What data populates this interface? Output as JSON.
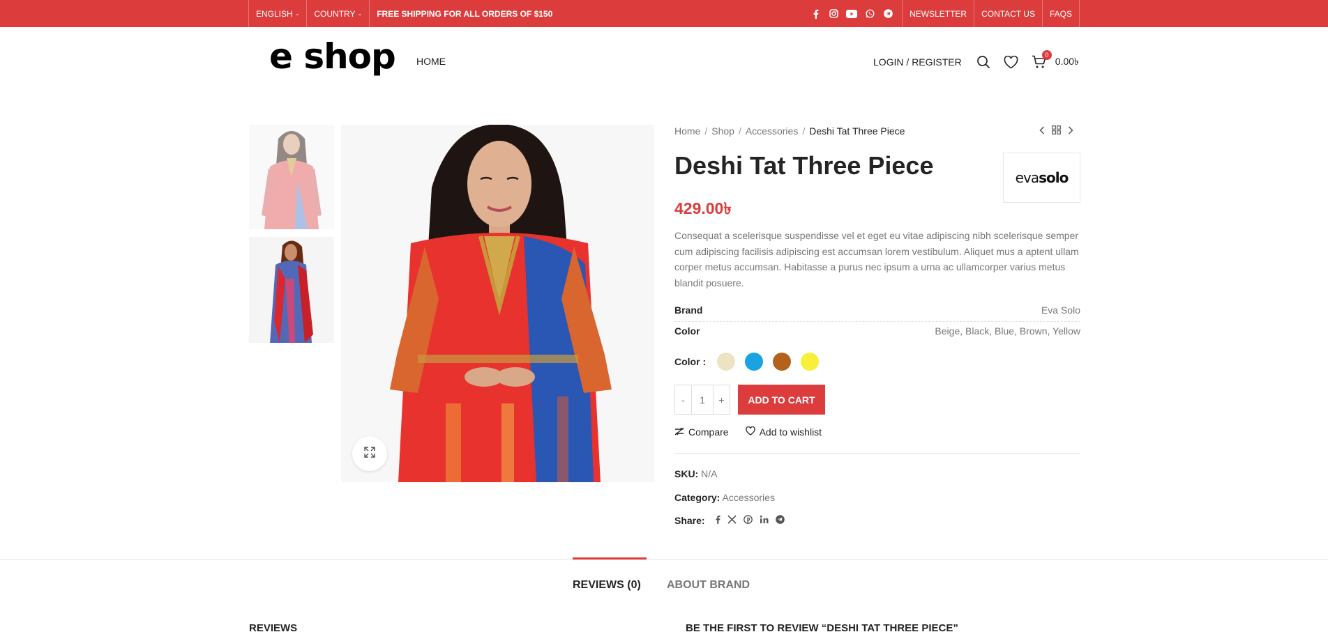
{
  "topbar": {
    "language": "ENGLISH",
    "country": "COUNTRY",
    "promo": "FREE SHIPPING FOR ALL ORDERS OF $150",
    "social_icons": [
      "facebook-icon",
      "instagram-icon",
      "youtube-icon",
      "whatsapp-icon",
      "telegram-icon"
    ],
    "links": [
      "NEWSLETTER",
      "CONTACT US",
      "FAQS"
    ]
  },
  "header": {
    "logo": "e shop",
    "nav": [
      "HOME"
    ],
    "login": "LOGIN / REGISTER",
    "cart_count": "0",
    "cart_total": "0.00৳"
  },
  "breadcrumb": {
    "items": [
      "Home",
      "Shop",
      "Accessories"
    ],
    "separator": "/",
    "current": "Deshi Tat Three Piece"
  },
  "product": {
    "title": "Deshi Tat Three Piece",
    "brand_logo": {
      "light": "eva",
      "bold": "solo"
    },
    "price": "429.00৳",
    "description": "Consequat a scelerisque suspendisse vel et eget eu vitae adipiscing nibh scelerisque semper cum adipiscing facilisis adipiscing est accumsan lorem vestibulum. Aliquet mus a aptent ullam corper metus accumsan. Habitasse a purus nec ipsum a urna ac ullamcorper varius metus blandit posuere.",
    "attributes": [
      {
        "key": "Brand",
        "value": "Eva Solo"
      },
      {
        "key": "Color",
        "value": "Beige, Black, Blue, Brown, Yellow"
      }
    ],
    "color_label": "Color :",
    "swatches": [
      "#ede2c3",
      "#1aa3e0",
      "#b3621c",
      "#f8ef3a"
    ],
    "qty_minus": "-",
    "qty_value": "1",
    "qty_plus": "+",
    "add_to_cart": "ADD TO CART",
    "compare": "Compare",
    "wishlist": "Add to wishlist",
    "sku_label": "SKU:",
    "sku": "N/A",
    "category_label": "Category:",
    "category": "Accessories",
    "share_label": "Share:",
    "share_icons": [
      "facebook-icon",
      "x-icon",
      "pinterest-icon",
      "linkedin-icon",
      "telegram-icon"
    ]
  },
  "tabs": [
    {
      "label": "REVIEWS (0)",
      "active": true
    },
    {
      "label": "ABOUT BRAND",
      "active": false
    }
  ],
  "reviews": {
    "heading": "REVIEWS",
    "form_heading": "BE THE FIRST TO REVIEW “DESHI TAT THREE PIECE”"
  },
  "colors": {
    "accent": "#dc3c3c",
    "text": "#242424",
    "muted": "#777777"
  }
}
